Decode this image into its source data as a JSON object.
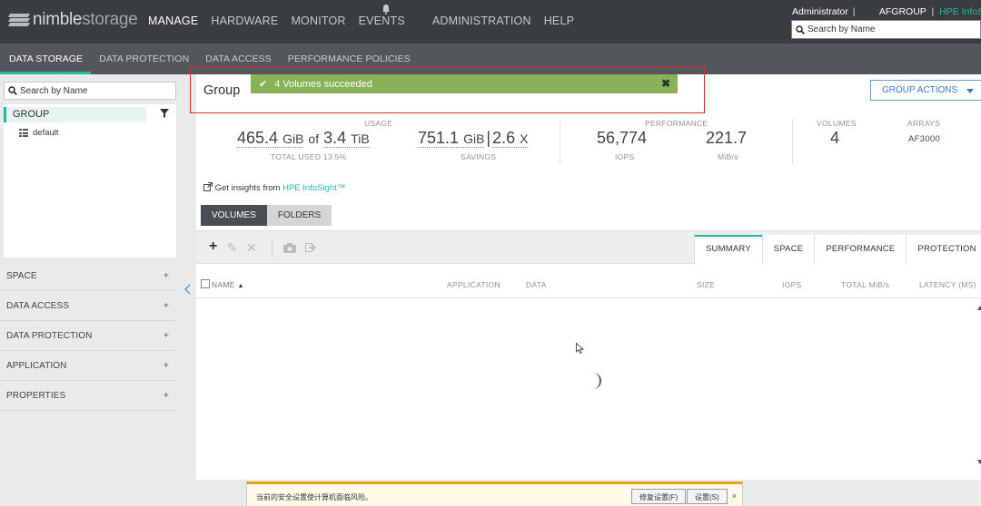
{
  "brand": {
    "name_a": "nimble",
    "name_b": "storage"
  },
  "topnav": [
    "MANAGE",
    "HARDWARE",
    "MONITOR",
    "EVENTS",
    "ADMINISTRATION",
    "HELP"
  ],
  "user": {
    "name": "Administrator",
    "sep": "|",
    "group": "AFGROUP",
    "sep2": "|",
    "link": "HPE InfoSight"
  },
  "top_search": {
    "placeholder": "Search by Name"
  },
  "subnav": [
    "DATA STORAGE",
    "DATA PROTECTION",
    "DATA ACCESS",
    "PERFORMANCE POLICIES"
  ],
  "left": {
    "search_placeholder": "Search by Name",
    "tree_group": "GROUP",
    "tree_child": "default",
    "accordion": [
      "SPACE",
      "DATA ACCESS",
      "DATA PROTECTION",
      "APPLICATION",
      "PROPERTIES"
    ],
    "plus": "+"
  },
  "main": {
    "title": "Group",
    "toast": "4 Volumes succeeded",
    "group_actions": "GROUP ACTIONS",
    "usage_label": "USAGE",
    "used_value": "465.4",
    "used_unit": "GiB",
    "of": "of",
    "total_value": "3.4",
    "total_unit": "TiB",
    "used_sub": "TOTAL USED 13.5%",
    "savings_value": "751.1",
    "savings_unit": "GiB",
    "savings_ratio": "2.6",
    "savings_x": "X",
    "savings_sub": "SAVINGS",
    "performance_label": "PERFORMANCE",
    "iops_value": "56,774",
    "iops_sub": "IOPS",
    "mibs_value": "221.7",
    "mibs_sub": "MiB/s",
    "volumes_label": "VOLUMES",
    "volumes_value": "4",
    "arrays_label": "ARRAYS",
    "arrays_value": "AF3000",
    "insights_text": "Get insights from ",
    "insights_link": "HPE InfoSight™",
    "seg": [
      "VOLUMES",
      "FOLDERS"
    ],
    "view_tabs": [
      "SUMMARY",
      "SPACE",
      "PERFORMANCE",
      "PROTECTION"
    ],
    "columns": [
      "NAME",
      "APPLICATION",
      "DATA",
      "SIZE",
      "IOPS",
      "TOTAL MiB/s",
      "LATENCY (MS)"
    ]
  },
  "security_bar": {
    "message": "当前的安全设置使计算机面临风险。",
    "fix_button": "修复设置(F)",
    "settings_button": "设置(S)",
    "close": "×"
  },
  "colors": {
    "accent": "#1cbf97",
    "toast": "#89b157",
    "topbar": "#3a3d40",
    "subbar": "#53575b",
    "link_blue": "#3a7bc8"
  }
}
